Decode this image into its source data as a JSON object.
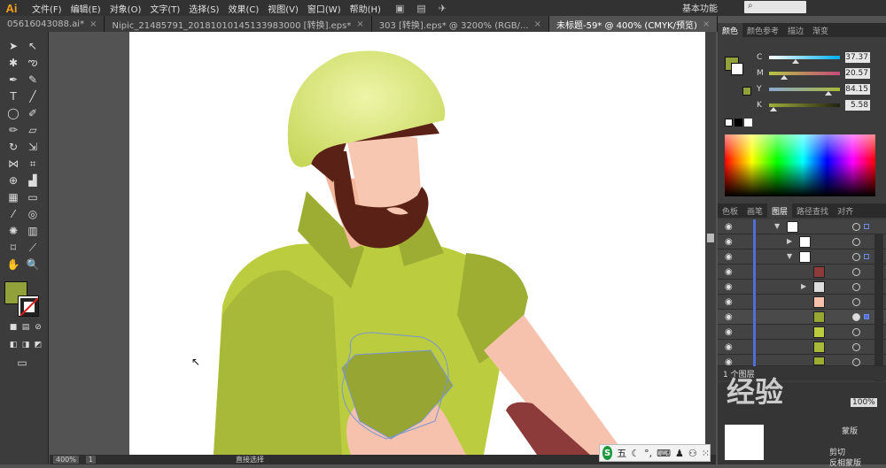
{
  "app": {
    "logo": "Ai",
    "workspace": "基本功能"
  },
  "menu": [
    "文件(F)",
    "编辑(E)",
    "对象(O)",
    "文字(T)",
    "选择(S)",
    "效果(C)",
    "视图(V)",
    "窗口(W)",
    "帮助(H)"
  ],
  "tabs": [
    {
      "label": "05616043088.ai*",
      "active": false
    },
    {
      "label": "Nipic_21485791_20181010145133983000 [转换].eps*",
      "active": false
    },
    {
      "label": "303 [转换].eps* @ 3200% (RGB/...",
      "active": false
    },
    {
      "label": "未标题-59* @ 400% (CMYK/预览)",
      "active": true
    }
  ],
  "panels": {
    "color_tabs": [
      "颜色",
      "颜色参考",
      "描边",
      "渐变"
    ],
    "cmyk": [
      {
        "label": "C",
        "value": "37.37",
        "pos": 0.37
      },
      {
        "label": "M",
        "value": "20.57",
        "pos": 0.21
      },
      {
        "label": "Y",
        "value": "84.15",
        "pos": 0.84
      },
      {
        "label": "K",
        "value": "5.58",
        "pos": 0.06
      }
    ],
    "layer_tabs": [
      "色板",
      "画笔",
      "图层",
      "路径查找",
      "对齐"
    ],
    "layers_count": "1 个图层",
    "zoom_bottom": "100%",
    "mask_label": "蒙版",
    "clip_label": "剪切",
    "invert_label": "反相蒙版"
  },
  "status": {
    "zoom": "400%",
    "page": "1",
    "tool": "直接选择"
  },
  "ime": {
    "label": "五"
  },
  "watermark": "经验",
  "colors": {
    "fill": "#93a13a",
    "accent": "#4f6fd6"
  }
}
